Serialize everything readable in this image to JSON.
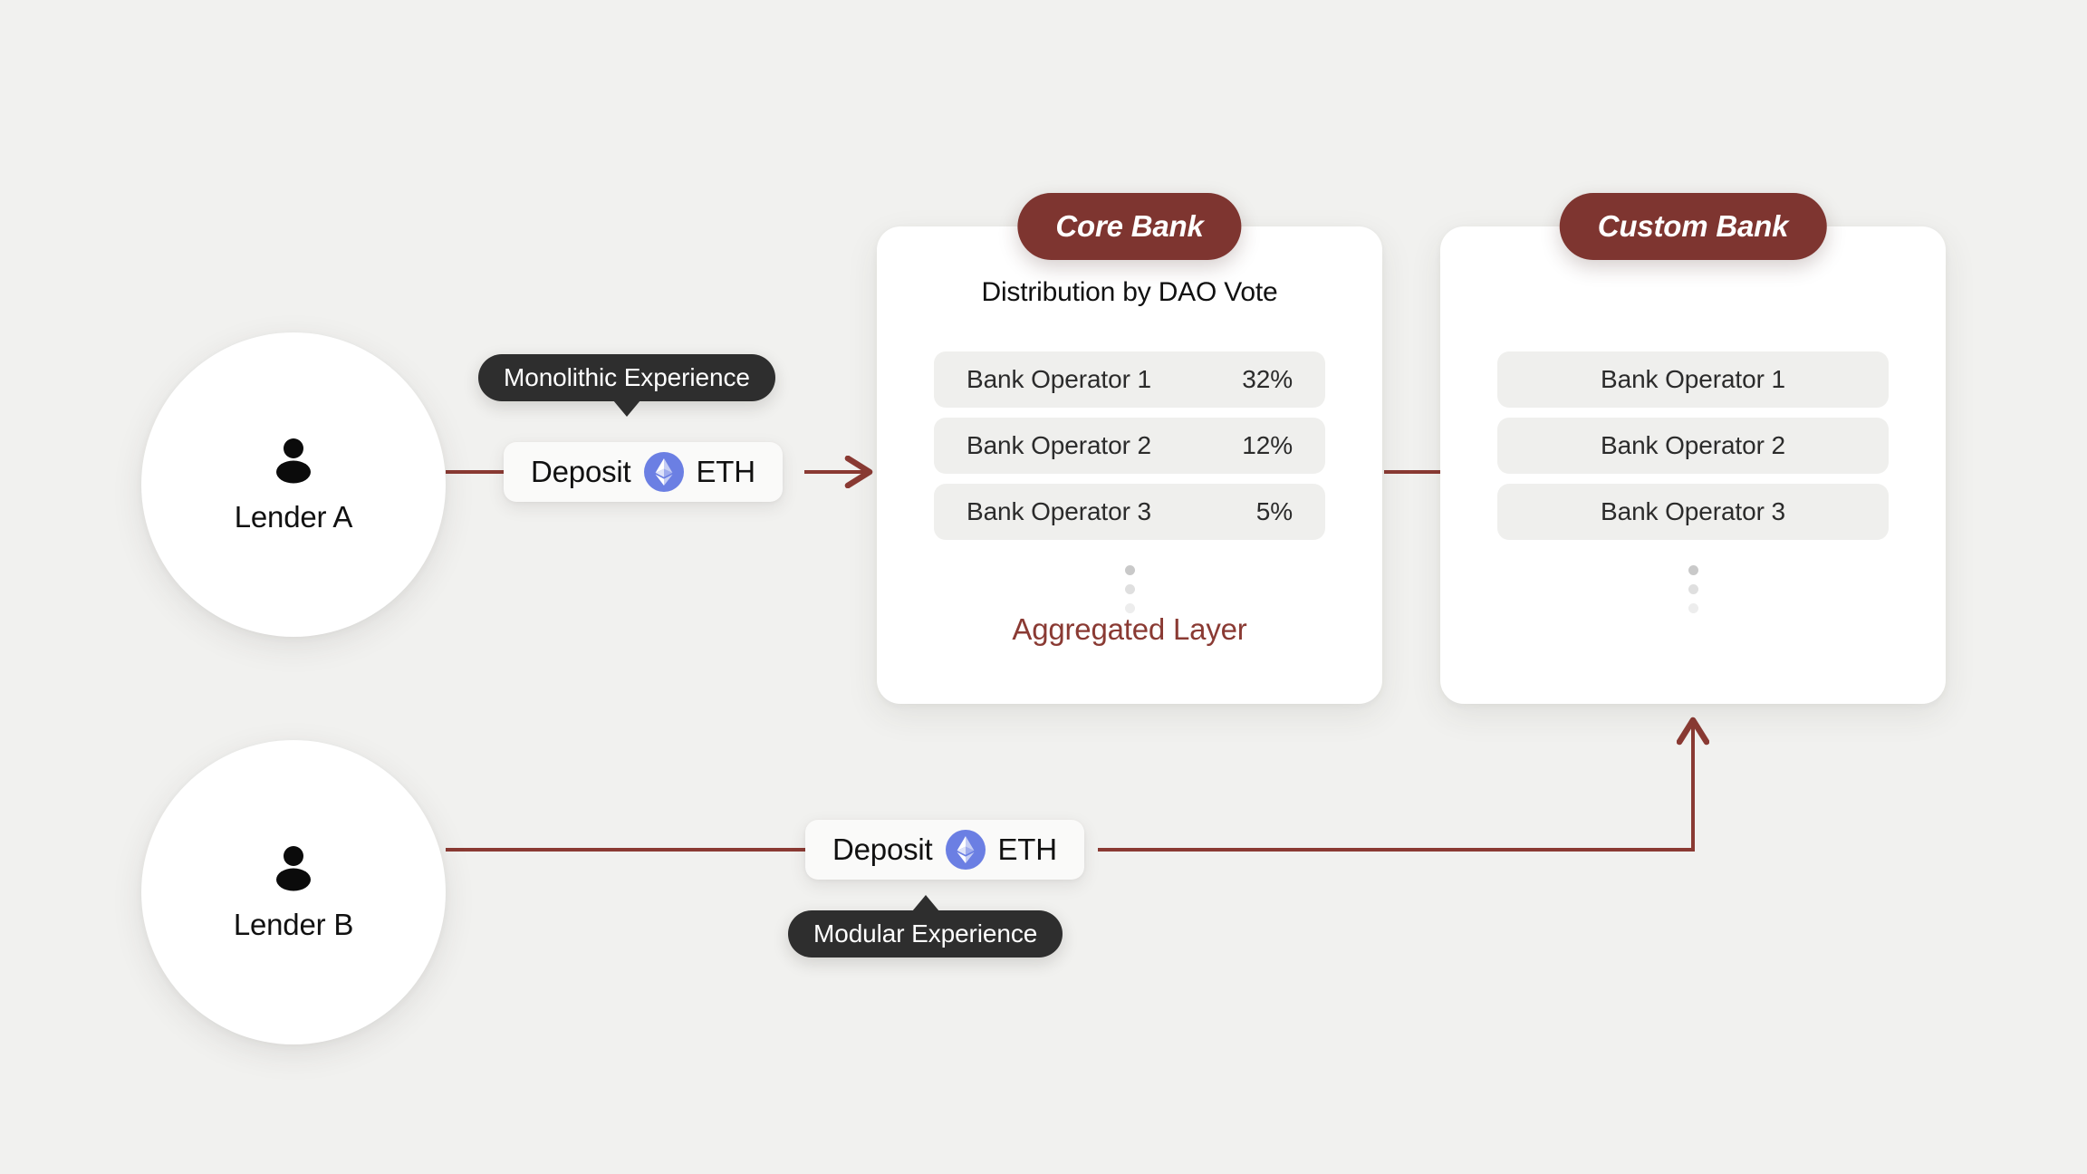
{
  "theme": {
    "background": "#F1F1EF",
    "card_bg": "#FFFFFF",
    "accent_red": "#7E3530",
    "accent_red_text": "#8A3A33",
    "tooltip_bg": "#2E2E2E",
    "row_bg": "#EFEFED",
    "eth_blue": "#6B7FE3",
    "connector": "#8A3A33"
  },
  "lenders": [
    {
      "id": "lender-a",
      "label": "Lender A",
      "icon": "person-icon"
    },
    {
      "id": "lender-b",
      "label": "Lender B",
      "icon": "person-icon"
    }
  ],
  "deposits": [
    {
      "id": "deposit-a",
      "label": "Deposit",
      "token": "ETH",
      "icon": "ethereum-icon"
    },
    {
      "id": "deposit-b",
      "label": "Deposit",
      "token": "ETH",
      "icon": "ethereum-icon"
    }
  ],
  "tooltips": [
    {
      "id": "tip-monolithic",
      "text": "Monolithic Experience",
      "pointer": "down"
    },
    {
      "id": "tip-modular",
      "text": "Modular Experience",
      "pointer": "up"
    }
  ],
  "core_bank": {
    "pill_label": "Core Bank",
    "subtitle": "Distribution by DAO Vote",
    "footer_label": "Aggregated Layer",
    "operators": [
      {
        "name": "Bank Operator 1",
        "pct": "32%"
      },
      {
        "name": "Bank Operator 2",
        "pct": "12%"
      },
      {
        "name": "Bank Operator 3",
        "pct": "5%"
      }
    ]
  },
  "custom_bank": {
    "pill_label": "Custom Bank",
    "operators": [
      {
        "name": "Bank Operator 1"
      },
      {
        "name": "Bank Operator 2"
      },
      {
        "name": "Bank Operator 3"
      }
    ]
  }
}
